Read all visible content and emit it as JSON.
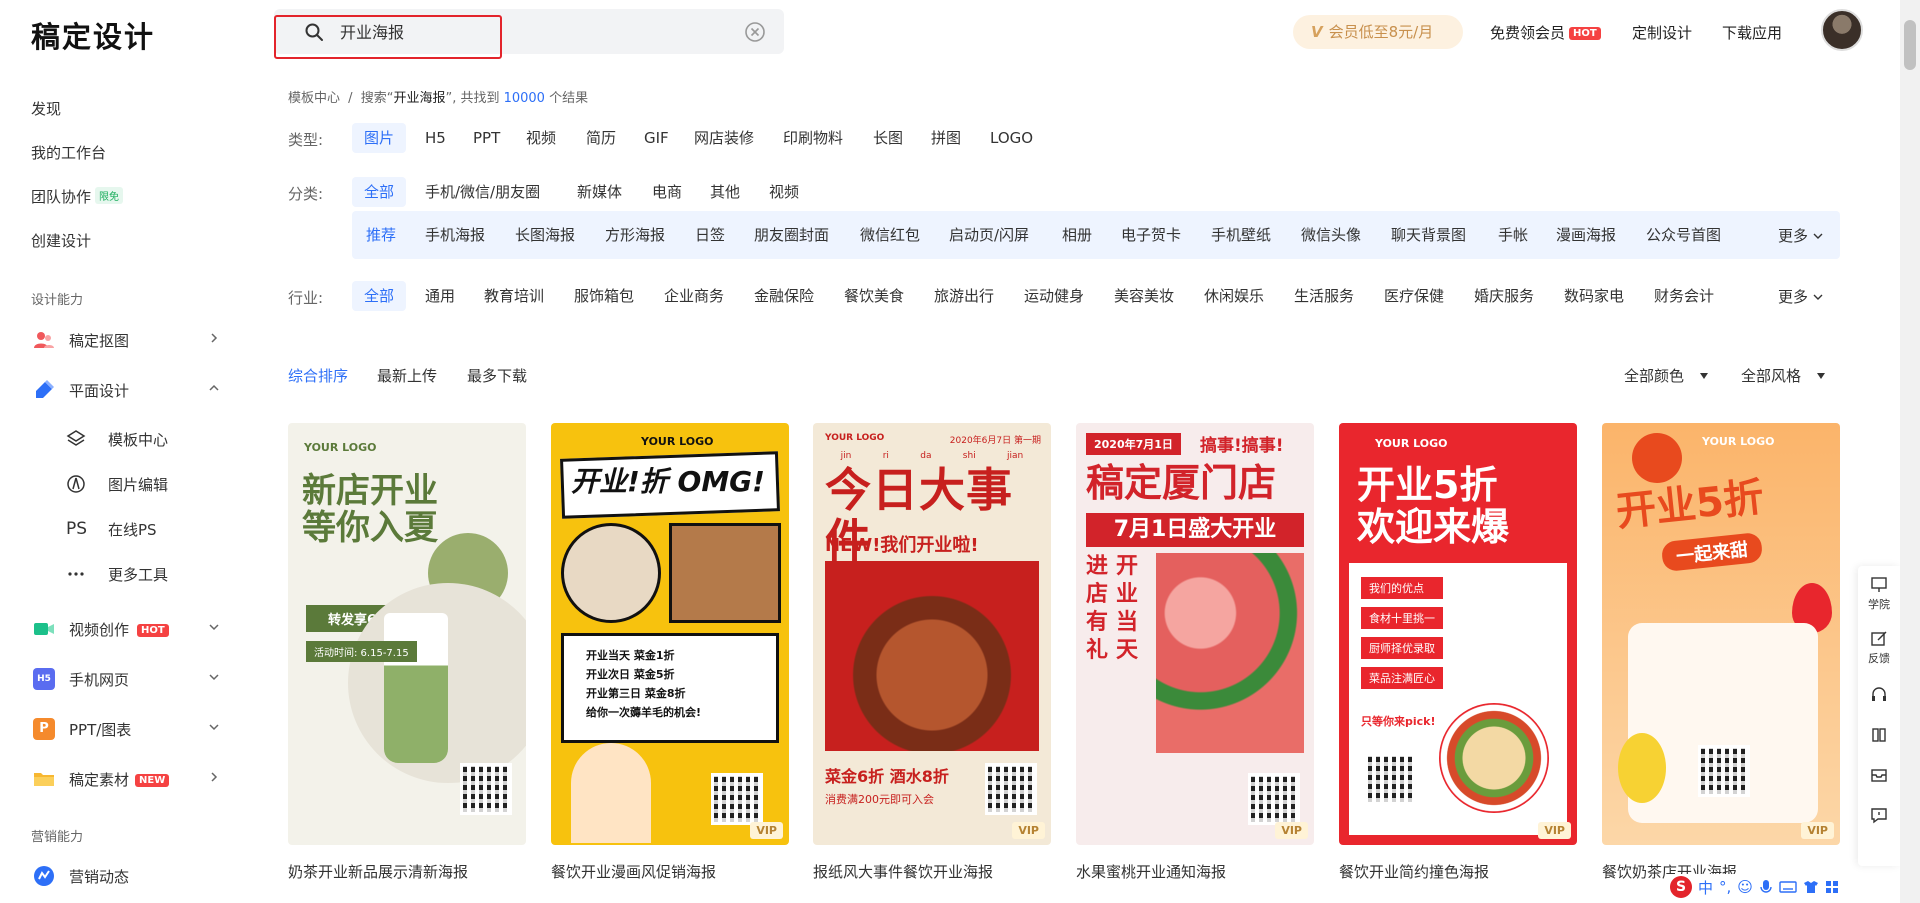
{
  "app": {
    "logo": "稿定设计"
  },
  "search": {
    "value": "开业海报"
  },
  "header": {
    "vip_promo": "会员低至8元/月",
    "vip_icon_text": "V",
    "free_vip": "免费领会员",
    "free_vip_badge": "HOT",
    "custom_design": "定制设计",
    "download_app": "下载应用"
  },
  "sidebar": {
    "discover": "发现",
    "workspace": "我的工作台",
    "team": "团队协作",
    "team_badge": "限免",
    "create": "创建设计",
    "section_design": "设计能力",
    "cutout": "稿定抠图",
    "graphic": "平面设计",
    "sub": {
      "templates": "模板中心",
      "image_edit": "图片编辑",
      "online_ps": "在线PS",
      "online_ps_icon": "PS",
      "more_tools": "更多工具"
    },
    "video": "视频创作",
    "video_badge": "HOT",
    "h5": "手机网页",
    "h5_icon": "H5",
    "ppt": "PPT/图表",
    "ppt_icon": "P",
    "material": "稿定素材",
    "material_badge": "NEW",
    "section_marketing": "营销能力",
    "marketing": "营销动态"
  },
  "breadcrumb": {
    "root": "模板中心",
    "sep": "/",
    "prefix": "搜索“",
    "query": "开业海报",
    "mid": "”, 共找到",
    "count": "10000",
    "suffix": "个结果"
  },
  "filters": {
    "type_label": "类型:",
    "types": [
      "图片",
      "H5",
      "PPT",
      "视频",
      "简历",
      "GIF",
      "网店装修",
      "印刷物料",
      "长图",
      "拼图",
      "LOGO"
    ],
    "category_label": "分类:",
    "categories": [
      "全部",
      "手机/微信/朋友圈",
      "新媒体",
      "电商",
      "其他",
      "视频"
    ],
    "subcategories": [
      "推荐",
      "手机海报",
      "长图海报",
      "方形海报",
      "日签",
      "朋友圈封面",
      "微信红包",
      "启动页/闪屏",
      "相册",
      "电子贺卡",
      "手机壁纸",
      "微信头像",
      "聊天背景图",
      "手帐",
      "漫画海报",
      "公众号首图"
    ],
    "more": "更多",
    "industry_label": "行业:",
    "industries": [
      "全部",
      "通用",
      "教育培训",
      "服饰箱包",
      "企业商务",
      "金融保险",
      "餐饮美食",
      "旅游出行",
      "运动健身",
      "美容美妆",
      "休闲娱乐",
      "生活服务",
      "医疗保健",
      "婚庆服务",
      "数码家电",
      "财务会计"
    ]
  },
  "sort": {
    "options": [
      "综合排序",
      "最新上传",
      "最多下载"
    ],
    "color": "全部颜色",
    "style": "全部风格"
  },
  "cards": [
    {
      "title": "奶茶开业新品展示清新海报",
      "poster": [
        "新店开业",
        "等你入夏"
      ],
      "logo": "YOUR LOGO",
      "ribbon": "转发享6折优惠",
      "date": "活动时间: 6.15-7.15",
      "bg": "#f3f2ea",
      "accent": "#5b7a3a",
      "vip": ""
    },
    {
      "title": "餐饮开业漫画风促销海报",
      "poster": [
        "开业!折 OMG!"
      ],
      "logo": "YOUR LOGO",
      "lines": [
        "开业当天 菜金1折",
        "开业次日 菜金5折",
        "开业第三日 菜金8折",
        "给你一次薅羊毛的机会!"
      ],
      "bg": "#f7c20e",
      "accent": "#111111",
      "vip": "VIP"
    },
    {
      "title": "报纸风大事件餐饮开业海报",
      "poster": [
        "今日大事件"
      ],
      "logo": "YOUR LOGO",
      "date": "2020年6月7日 第一期",
      "pinyin": [
        "jin",
        "ri",
        "da",
        "shi",
        "jian"
      ],
      "sub": "NEW!我们开业啦!",
      "promo": [
        "菜金6折 酒水8折",
        "消费满200元即可入会"
      ],
      "bg": "#f3e9d7",
      "accent": "#c7201e",
      "vip": "VIP"
    },
    {
      "title": "水果蜜桃开业通知海报",
      "poster": [
        "稿定厦门店"
      ],
      "date": "2020年7月1日",
      "exclaim": "搞事!搞事!",
      "banner": "7月1日盛大开业",
      "side": [
        "进",
        "店",
        "有",
        "礼"
      ],
      "side2": [
        "开",
        "业",
        "当",
        "天"
      ],
      "bg": "#f7ecec",
      "accent": "#d2232a",
      "vip": "VIP"
    },
    {
      "title": "餐饮开业简约撞色海报",
      "poster": [
        "开业5折",
        "欢迎来爆"
      ],
      "logo": "YOUR LOGO",
      "tags": [
        "我们的优点",
        "食材十里挑一",
        "厨师择优录取",
        "菜品注满匠心"
      ],
      "pick": "只等你来pick!",
      "bg": "#ffffff",
      "accent": "#e9262d",
      "vip": "VIP"
    },
    {
      "title": "餐饮奶茶店开业海报",
      "poster": [
        "开业5折",
        "一起来甜"
      ],
      "logo": "YOUR LOGO",
      "bg": "#fcd7a8",
      "accent": "#e84a1e",
      "vip": "VIP"
    }
  ],
  "float_bar": {
    "academy": "学院",
    "feedback": "反馈"
  },
  "ime": {
    "lang": "中",
    "punct": "°,"
  },
  "colors": {
    "accent": "#2d6ff7",
    "danger": "#e3242b"
  }
}
